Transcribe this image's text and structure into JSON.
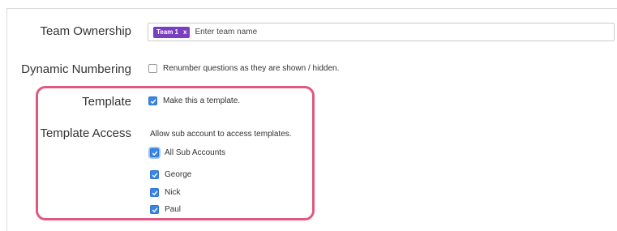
{
  "team_ownership": {
    "label": "Team Ownership",
    "tag_label": "Team 1",
    "tag_remove": "x",
    "placeholder": "Enter team name"
  },
  "dynamic_numbering": {
    "label": "Dynamic Numbering",
    "checkbox_label": "Renumber questions as they are shown / hidden.",
    "checked": false
  },
  "template": {
    "label": "Template",
    "checkbox_label": "Make this a template.",
    "checked": true
  },
  "template_access": {
    "label": "Template Access",
    "description": "Allow sub account to access templates.",
    "all_label": "All Sub Accounts",
    "accounts": [
      {
        "label": "George",
        "checked": true
      },
      {
        "label": "Nick",
        "checked": true
      },
      {
        "label": "Paul",
        "checked": true
      }
    ]
  },
  "colors": {
    "tag": "#7a3fbf",
    "checkbox": "#3a86e6",
    "highlight": "#e0587f"
  }
}
